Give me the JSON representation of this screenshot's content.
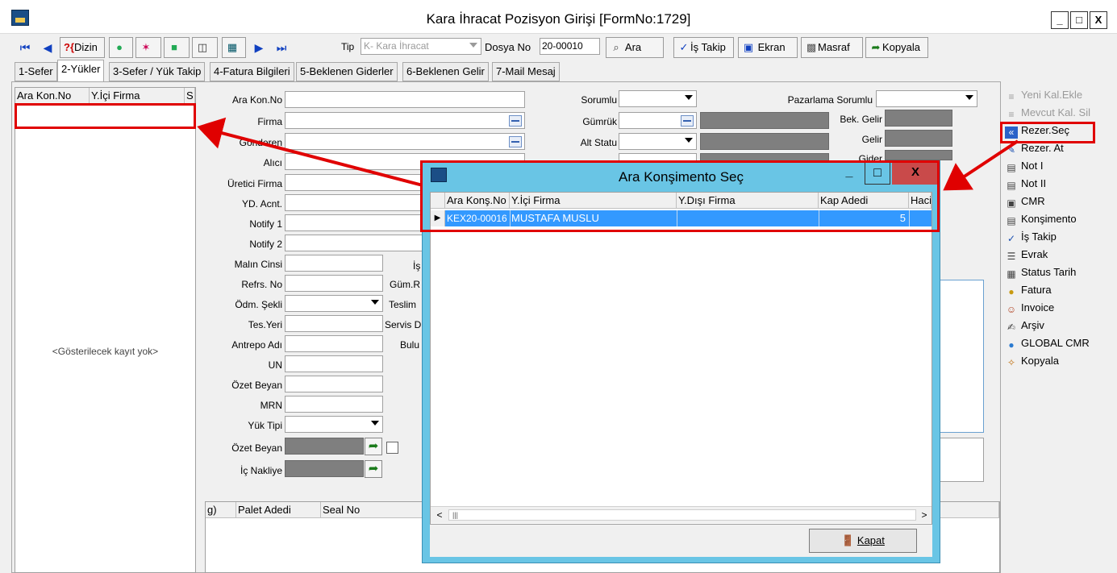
{
  "window": {
    "title": "Kara İhracat Pozisyon Girişi [FormNo:1729]",
    "controls": [
      "_",
      "□",
      "X"
    ]
  },
  "toolbar": {
    "dizin_label": "Dizin",
    "tip_label": "Tip",
    "tip_value": "K- Kara İhracat",
    "dosya_label": "Dosya No",
    "dosya_value": "20-00010",
    "ara_label": "Ara",
    "is_takip_label": "İş Takip",
    "ekran_label": "Ekran",
    "masraf_label": "Masraf",
    "kopyala_label": "Kopyala"
  },
  "tabs": [
    "1-Sefer",
    "2-Yükler",
    "3-Sefer / Yük Takip",
    "4-Fatura Bilgileri",
    "5-Beklenen Giderler",
    "6-Beklenen Gelir",
    "7-Mail Mesaj"
  ],
  "left_list": {
    "columns": [
      "Ara Kon.No",
      "Y.İçi Firma",
      "S"
    ],
    "empty_text": "<Gösterilecek kayıt yok>"
  },
  "form": {
    "left_labels": [
      "Ara Kon.No",
      "Firma",
      "Gönderen",
      "Alıcı",
      "Üretici Firma",
      "YD. Acnt.",
      "Notify 1",
      "Notify 2",
      "Malın Cinsi",
      "Refrs. No",
      "Ödm. Şekli",
      "Tes.Yeri",
      "Antrepo Adı",
      "UN",
      "Özet Beyan",
      "MRN",
      "Yük Tipi",
      "Özet Beyan",
      "İç Nakliye"
    ],
    "mid_labels": [
      "İş",
      "Güm.R",
      "Teslim",
      "Servis D",
      "Bulu"
    ],
    "right_labels": [
      "Sorumlu",
      "Gümrük",
      "Alt Statu"
    ],
    "pazarlama_label": "Pazarlama Sorumlu",
    "income_labels": [
      "Bek. Gelir",
      "Gelir",
      "Gider"
    ],
    "bottom_grid_columns": [
      "g)",
      "Palet Adedi",
      "Seal No"
    ]
  },
  "right_panel": [
    {
      "label": "Yeni Kal.Ekle",
      "icon": "add-row-icon",
      "disabled": true
    },
    {
      "label": "Mevcut Kal. Sil",
      "icon": "delete-row-icon",
      "disabled": true
    },
    {
      "label": "Rezer.Seç",
      "icon": "rewind-icon",
      "disabled": false
    },
    {
      "label": "Rezer. At",
      "icon": "pencil-icon",
      "disabled": false
    },
    {
      "label": "Not I",
      "icon": "note-icon",
      "disabled": false
    },
    {
      "label": "Not II",
      "icon": "note-icon",
      "disabled": false
    },
    {
      "label": "CMR",
      "icon": "copy-document-icon",
      "disabled": false
    },
    {
      "label": "Konşimento",
      "icon": "document-icon",
      "disabled": false
    },
    {
      "label": "İş Takip",
      "icon": "checklist-icon",
      "disabled": false
    },
    {
      "label": "Evrak",
      "icon": "lines-icon",
      "disabled": false
    },
    {
      "label": "Status Tarih",
      "icon": "calendar-icon",
      "disabled": false
    },
    {
      "label": "Fatura",
      "icon": "coins-icon",
      "disabled": false
    },
    {
      "label": "Invoice",
      "icon": "people-icon",
      "disabled": false
    },
    {
      "label": "Arşiv",
      "icon": "archive-icon",
      "disabled": false
    },
    {
      "label": "GLOBAL CMR",
      "icon": "globe-icon",
      "disabled": false
    },
    {
      "label": "Kopyala",
      "icon": "wand-icon",
      "disabled": false
    }
  ],
  "dialog": {
    "title": "Ara Konşimento Seç",
    "controls": [
      "_",
      "□",
      "X"
    ],
    "columns": [
      "Ara Konş.No",
      "Y.İçi Firma",
      "Y.Dışı Firma",
      "Kap Adedi",
      "Hacil"
    ],
    "rows": [
      {
        "ara_kons_no": "KEX20-00016",
        "yici_firma": "MUSTAFA MUSLU",
        "ydisi_firma": "",
        "kap_adedi": "5",
        "hacim": ""
      }
    ],
    "kapat_label": "Kapat"
  },
  "colors": {
    "highlight_red": "#e00000",
    "dialog_frame": "#69c5e5",
    "selected_row": "#3399ff",
    "disabled_field": "#7f7f7f"
  }
}
